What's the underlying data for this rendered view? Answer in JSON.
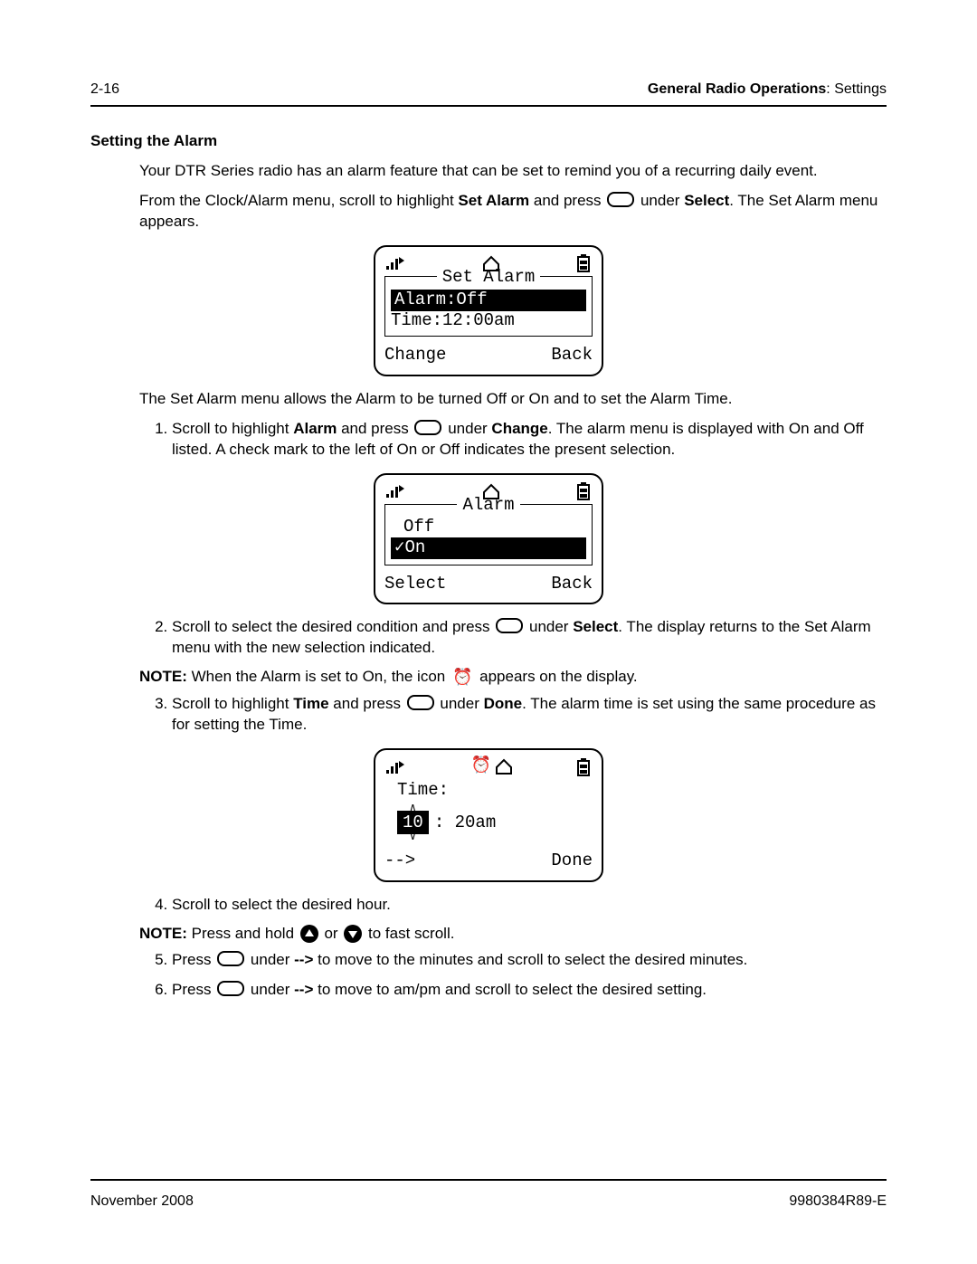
{
  "header": {
    "page_num": "2-16",
    "crumb_bold": "General Radio Operations",
    "crumb_tail": ": Settings"
  },
  "section_title": "Setting the Alarm",
  "para1": "Your DTR Series radio has an alarm feature that can be set to remind you of a recurring daily event.",
  "para2_a": "From the Clock/Alarm menu, scroll to highlight ",
  "para2_b": "Set Alarm",
  "para2_c": " and press ",
  "para2_d": " under ",
  "para2_e": "Select",
  "para2_f": ". The Set Alarm menu appears.",
  "screen1": {
    "title": "Set Alarm",
    "row1": "Alarm:Off",
    "row2": "Time:12:00am",
    "left": "Change",
    "right": "Back"
  },
  "para3": "The Set Alarm menu allows the Alarm to be turned Off or On and to set the Alarm Time.",
  "step1_a": "Scroll to highlight ",
  "step1_b": "Alarm",
  "step1_c": " and press ",
  "step1_d": " under ",
  "step1_e": "Change",
  "step1_f": ". The alarm menu is displayed with On and Off listed. A check mark to the left of On or Off indicates the present selection.",
  "screen2": {
    "title": "Alarm",
    "row1": "Off",
    "row2": "On",
    "left": "Select",
    "right": "Back"
  },
  "step2_a": "Scroll to select the desired condition and press ",
  "step2_b": " under ",
  "step2_c": "Select",
  "step2_d": ". The display returns to the Set Alarm menu with the new selection indicated.",
  "note1_label": "NOTE:",
  "note1_a": " When the Alarm is set to On, the icon ",
  "note1_b": " appears on the display.",
  "step3_a": "Scroll to highlight ",
  "step3_b": "Time",
  "step3_c": " and press ",
  "step3_d": " under ",
  "step3_e": "Done",
  "step3_f": ". The alarm time is set using the same procedure as for setting the Time.",
  "screen3": {
    "label": "Time:",
    "hour": "10",
    "rest": ":  20am",
    "left": "-->",
    "right": "Done"
  },
  "step4": "Scroll to select the desired hour.",
  "note2_label": "NOTE:",
  "note2_a": " Press and hold ",
  "note2_b": " or ",
  "note2_c": " to fast scroll.",
  "step5_a": "Press ",
  "step5_b": " under ",
  "step5_c": "-->",
  "step5_d": " to move to the minutes and scroll to select the desired minutes.",
  "step6_a": "Press ",
  "step6_b": " under ",
  "step6_c": "-->",
  "step6_d": " to move to am/pm and scroll to select the desired setting.",
  "footer": {
    "date": "November 2008",
    "doc": "9980384R89-E"
  }
}
